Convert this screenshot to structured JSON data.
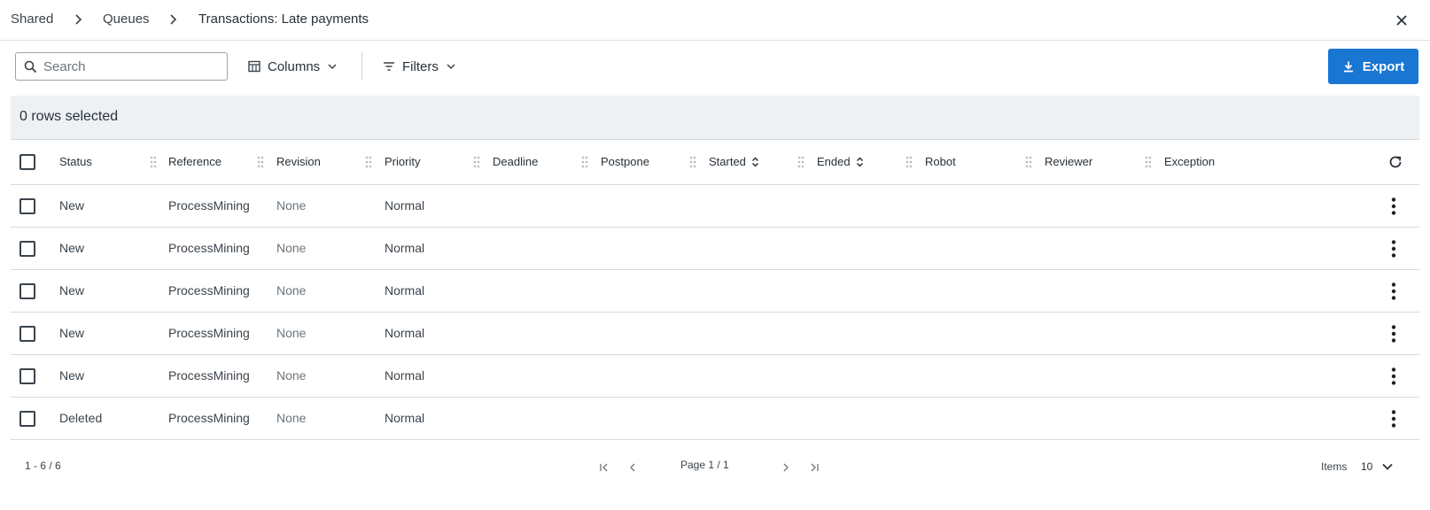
{
  "breadcrumb": {
    "items": [
      "Shared",
      "Queues",
      "Transactions: Late payments"
    ]
  },
  "toolbar": {
    "search_placeholder": "Search",
    "columns_label": "Columns",
    "filters_label": "Filters",
    "export_label": "Export"
  },
  "selection": {
    "text": "0 rows selected"
  },
  "table": {
    "columns": [
      "Status",
      "Reference",
      "Revision",
      "Priority",
      "Deadline",
      "Postpone",
      "Started",
      "Ended",
      "Robot",
      "Reviewer",
      "Exception"
    ],
    "rows": [
      {
        "status": "New",
        "reference": "ProcessMining",
        "revision": "None",
        "priority": "Normal"
      },
      {
        "status": "New",
        "reference": "ProcessMining",
        "revision": "None",
        "priority": "Normal"
      },
      {
        "status": "New",
        "reference": "ProcessMining",
        "revision": "None",
        "priority": "Normal"
      },
      {
        "status": "New",
        "reference": "ProcessMining",
        "revision": "None",
        "priority": "Normal"
      },
      {
        "status": "New",
        "reference": "ProcessMining",
        "revision": "None",
        "priority": "Normal"
      },
      {
        "status": "Deleted",
        "reference": "ProcessMining",
        "revision": "None",
        "priority": "Normal"
      }
    ]
  },
  "pagination": {
    "range": "1 - 6 / 6",
    "page": "Page 1 / 1",
    "items_label": "Items",
    "items_value": "10"
  },
  "colors": {
    "accent": "#1976d2",
    "header_bg": "#eef1f4",
    "text": "#273139"
  },
  "icons": {
    "close": "close-icon",
    "search": "search-icon",
    "columns": "columns-icon",
    "filters": "filter-icon",
    "export": "download-icon",
    "refresh": "refresh-icon",
    "row_menu": "more-vertical-icon"
  }
}
